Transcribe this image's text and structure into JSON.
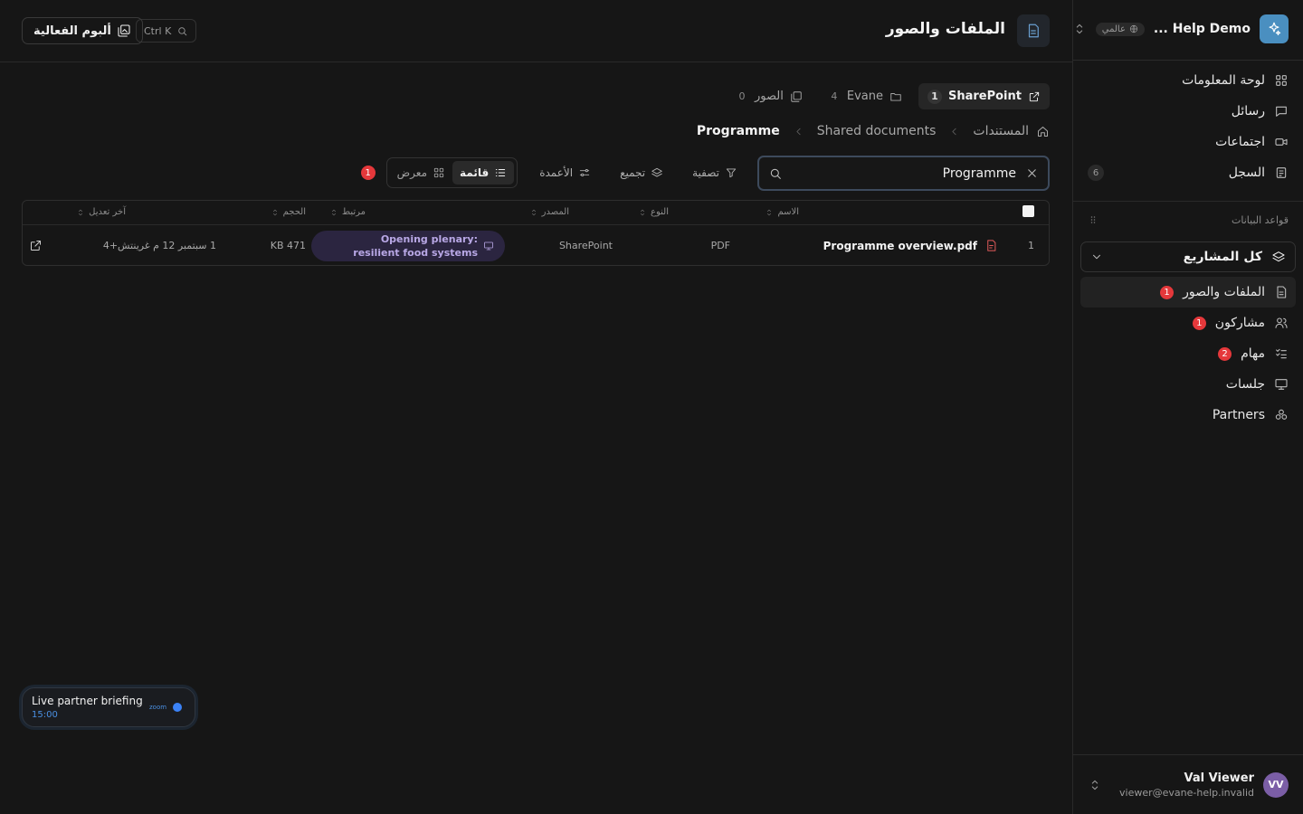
{
  "workspace": {
    "name": "Help Demo ...",
    "scope": "عالمي"
  },
  "sidebar": {
    "top_items": [
      {
        "label": "لوحة المعلومات",
        "icon": "dashboard-icon"
      },
      {
        "label": "رسائل",
        "icon": "message-icon"
      },
      {
        "label": "اجتماعات",
        "icon": "video-icon"
      },
      {
        "label": "السجل",
        "icon": "log-icon",
        "count": "6"
      }
    ],
    "databases_label": "قواعد البيانات",
    "project_select": "كل المشاريع",
    "db_items": [
      {
        "label": "الملفات والصور",
        "icon": "file-icon",
        "badge": "1"
      },
      {
        "label": "مشاركون",
        "icon": "users-icon",
        "badge": "1"
      },
      {
        "label": "مهام",
        "icon": "tasks-icon",
        "badge": "2"
      },
      {
        "label": "جلسات",
        "icon": "presentation-icon"
      },
      {
        "label": "Partners",
        "icon": "partners-icon"
      }
    ]
  },
  "user": {
    "initials": "VV",
    "name": "Val Viewer",
    "email": "viewer@evane-help.invalid"
  },
  "header": {
    "title": "الملفات والصور",
    "album_button": "ألبوم الفعالية",
    "shortcut": "Ctrl K"
  },
  "source_tabs": [
    {
      "label": "SharePoint",
      "count": "1"
    },
    {
      "label": "Evane",
      "count": "4"
    },
    {
      "label": "الصور",
      "count": "0"
    }
  ],
  "breadcrumb": {
    "root": "المستندات",
    "middle": "Shared documents",
    "current": "Programme"
  },
  "search": {
    "value": "Programme"
  },
  "toolbar": {
    "filter": "تصفية",
    "group": "تجميع",
    "columns": "الأعمدة",
    "list_view": "قائمة",
    "gallery_view": "معرض",
    "badge": "1"
  },
  "table": {
    "columns": {
      "name": "الاسم",
      "type": "النوع",
      "source": "المصدر",
      "linked": "مرتبط",
      "size": "الحجم",
      "modified": "آخر تعديل"
    },
    "rows": [
      {
        "index": "1",
        "name": "Programme overview.pdf",
        "type": "PDF",
        "source": "SharePoint",
        "linked": "Opening plenary: resilient food systems",
        "size": "471 KB",
        "modified": "1 سبتمبر 12 م غرينتش+4"
      }
    ]
  },
  "live_event": {
    "title": "Live partner briefing",
    "time": "15:00",
    "provider": "zoom"
  },
  "colors": {
    "accent": "#4a8fc0",
    "badge_red": "#e5383b",
    "linked_pill_bg": "#2b2540",
    "live_blue": "#3b82f6"
  }
}
